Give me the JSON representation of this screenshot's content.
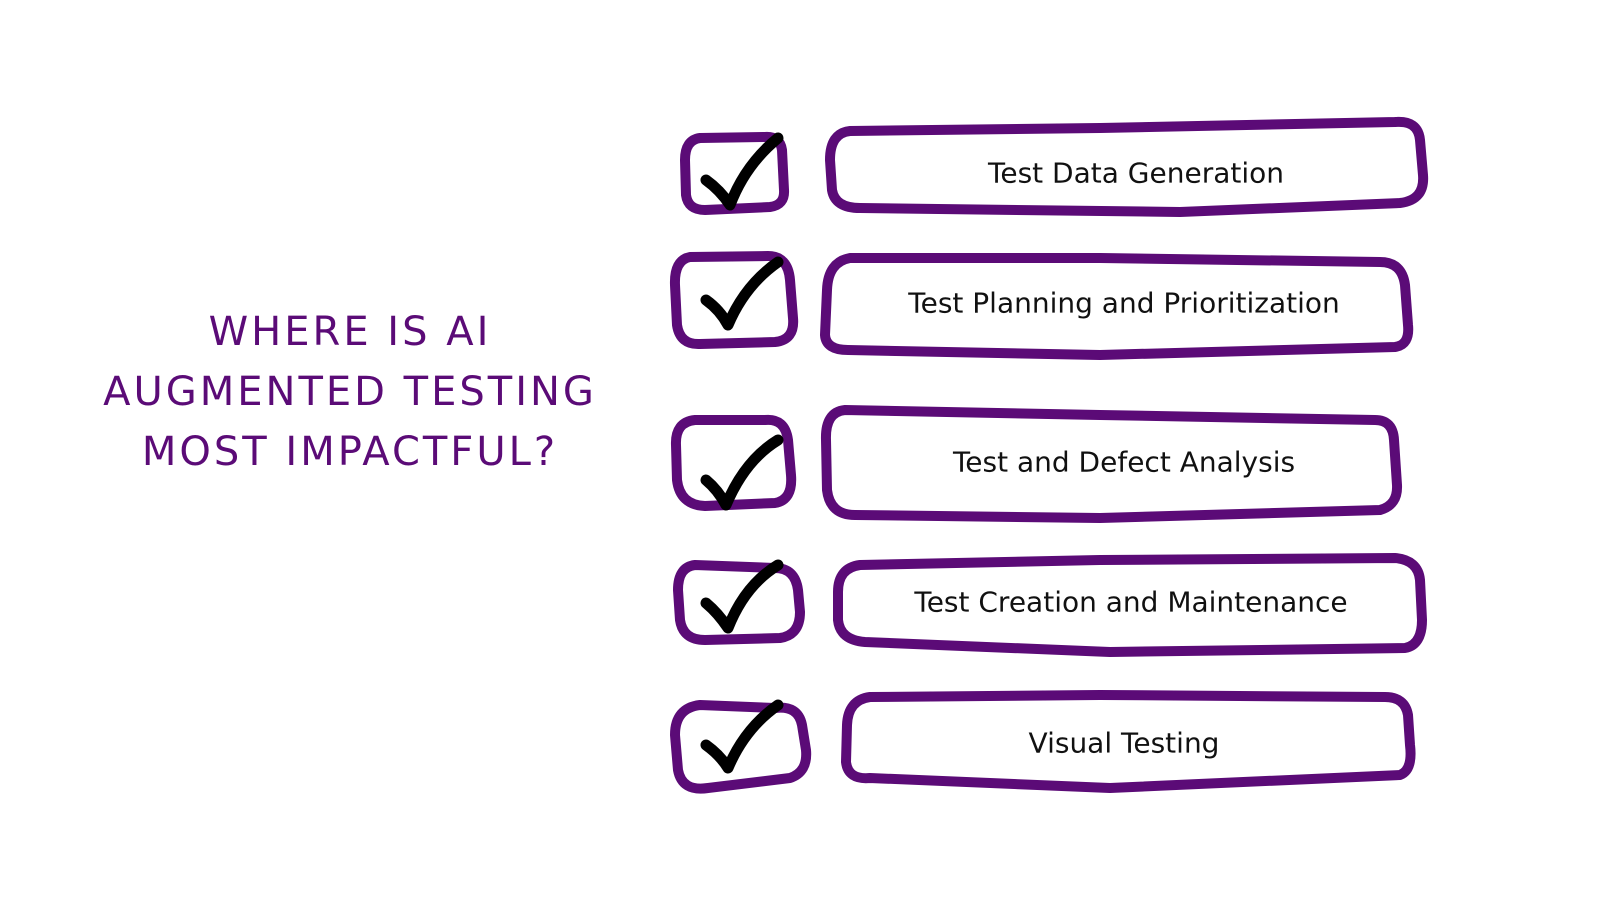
{
  "title": {
    "lines": [
      "WHERE IS AI",
      "AUGMENTED TESTING",
      "MOST IMPACTFUL?"
    ]
  },
  "colors": {
    "accent": "#5b0b77",
    "text": "#111111",
    "check": "#000000",
    "background": "#ffffff"
  },
  "checklist": [
    {
      "label": "Test Data Generation",
      "checked": true,
      "icon": "checkmark-icon"
    },
    {
      "label": "Test Planning and Prioritization",
      "checked": true,
      "icon": "checkmark-icon"
    },
    {
      "label": "Test and Defect Analysis",
      "checked": true,
      "icon": "checkmark-icon"
    },
    {
      "label": "Test Creation and Maintenance",
      "checked": true,
      "icon": "checkmark-icon"
    },
    {
      "label": "Visual Testing",
      "checked": true,
      "icon": "checkmark-icon"
    }
  ]
}
